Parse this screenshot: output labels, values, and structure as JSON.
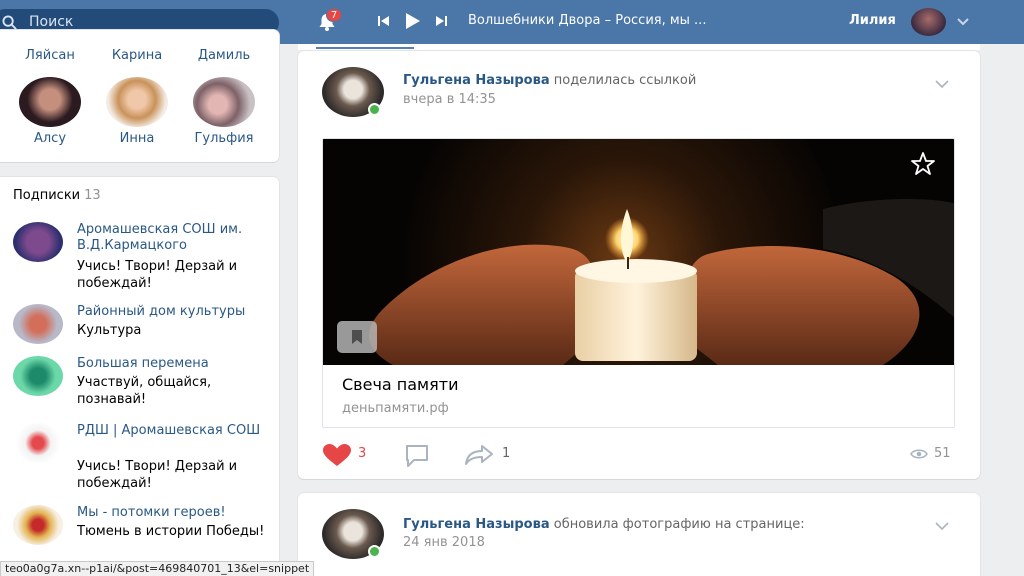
{
  "header": {
    "search_placeholder": "Поиск",
    "notifications_count": "7",
    "track_title": "Волшебники Двора – Россия, мы ...",
    "user_name": "Лилия"
  },
  "friends": [
    {
      "name": "Ляйсан"
    },
    {
      "name": "Карина"
    },
    {
      "name": "Дамиль"
    },
    {
      "name": "Алсу"
    },
    {
      "name": "Инна"
    },
    {
      "name": "Гульфия"
    }
  ],
  "subscriptions": {
    "title": "Подписки",
    "count": "13",
    "items": [
      {
        "title": "Аромашевская СОШ им. В.Д.Кармацкого",
        "desc": "Учись! Твори! Дерзай и побеждай!"
      },
      {
        "title": "Районный дом культуры",
        "desc": "Культура"
      },
      {
        "title": "Большая перемена",
        "desc": "Участвуй, общайся, познавай!"
      },
      {
        "title": "РДШ | Аромашевская СОШ",
        "desc": "Учись! Твори! Дерзай и побеждай!"
      },
      {
        "title": "Мы - потомки героев!",
        "desc": "Тюмень в истории Победы!"
      }
    ]
  },
  "posts": [
    {
      "author": "Гульгена Назырова",
      "action": "поделилась ссылкой",
      "date": "вчера в 14:35",
      "link_title": "Свеча памяти",
      "link_domain": "деньпамяти.рф",
      "likes": "3",
      "shares": "1",
      "views": "51"
    },
    {
      "author": "Гульгена Назырова",
      "action": "обновила фотографию на странице:",
      "date": "24 янв 2018"
    }
  ],
  "status_bar": {
    "url": "teo0a0g7a.xn--p1ai/&post=469840701_13&el=snippet"
  },
  "colors": {
    "header_bg": "#4a76a8",
    "link": "#2a5885",
    "like_red": "#e64646",
    "online_green": "#4bb34b"
  }
}
